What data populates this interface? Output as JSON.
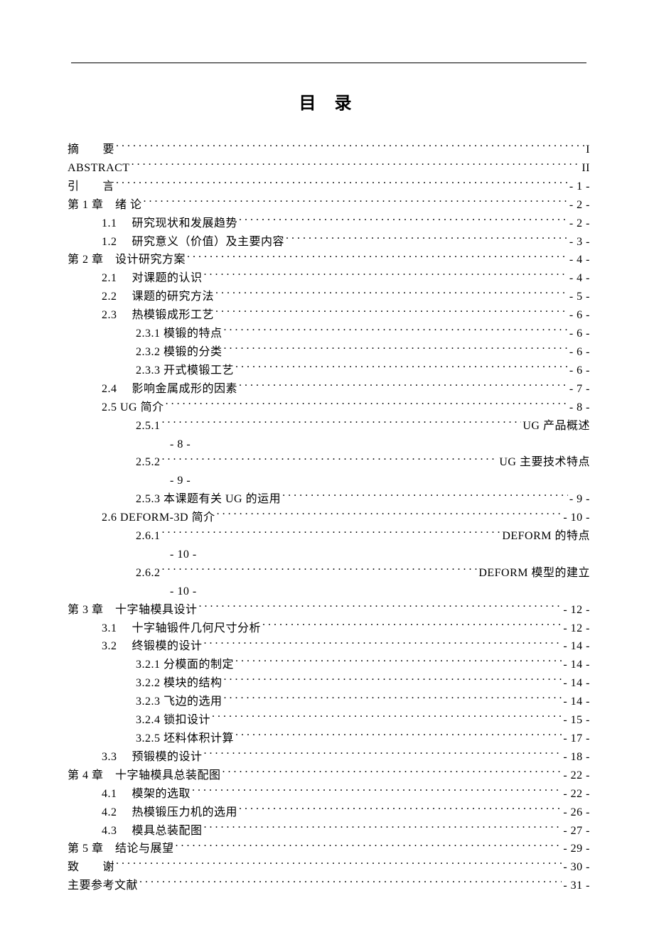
{
  "title": "目 录",
  "entries": [
    {
      "level": 0,
      "label": "摘　　要",
      "page": "I"
    },
    {
      "level": 0,
      "label": "ABSTRACT",
      "page": "II"
    },
    {
      "level": 0,
      "label": "引　　言",
      "page": "- 1 -"
    },
    {
      "level": 0,
      "label": "第 1 章　绪 论",
      "page": "- 2 -"
    },
    {
      "level": 1,
      "label": "1.1　 研究现状和发展趋势",
      "page": "- 2 -"
    },
    {
      "level": 1,
      "label": "1.2　 研究意义（价值）及主要内容",
      "page": "- 3 -"
    },
    {
      "level": 0,
      "label": "第 2 章　设计研究方案",
      "page": "- 4 -"
    },
    {
      "level": 1,
      "label": "2.1　 对课题的认识",
      "page": "- 4 -"
    },
    {
      "level": 1,
      "label": "2.2　 课题的研究方法",
      "page": "- 5 -"
    },
    {
      "level": 1,
      "label": "2.3　 热模锻成形工艺",
      "page": "- 6 -"
    },
    {
      "level": 2,
      "label": "2.3.1 模锻的特点",
      "page": "- 6 -"
    },
    {
      "level": 2,
      "label": "2.3.2 模锻的分类",
      "page": "- 6 -"
    },
    {
      "level": 2,
      "label": "2.3.3 开式模锻工艺",
      "page": "- 6 -"
    },
    {
      "level": 1,
      "label": "2.4　 影响金属成形的因素",
      "page": "- 7 -"
    },
    {
      "level": 1,
      "label": "2.5  UG 简介 ",
      "page": "- 8 -"
    },
    {
      "level": 2,
      "wrap": true,
      "label": "2.5.1 ",
      "tail": "UG 产品概述",
      "page2": "- 8 -"
    },
    {
      "level": 2,
      "wrap": true,
      "label": "2.5.2",
      "tail": "UG 主要技术特点",
      "page2": "- 9 -"
    },
    {
      "level": 2,
      "label": "2.5.3 本课题有关 UG 的运用",
      "page": "- 9 -"
    },
    {
      "level": 1,
      "label": "2.6  DEFORM-3D 简介 ",
      "page": "- 10 -"
    },
    {
      "level": 2,
      "wrap": true,
      "label": "2.6.1 ",
      "tail": "DEFORM 的特点",
      "page2": "- 10 -"
    },
    {
      "level": 2,
      "wrap": true,
      "label": "2.6.2",
      "tail": "DEFORM 模型的建立",
      "page2": "- 10 -"
    },
    {
      "level": 0,
      "label": "第 3 章　十字轴模具设计",
      "page": "- 12 -"
    },
    {
      "level": 1,
      "label": "3.1　 十字轴锻件几何尺寸分析",
      "page": "- 12 -"
    },
    {
      "level": 1,
      "label": "3.2　 终锻模的设计",
      "page": "- 14 -"
    },
    {
      "level": 2,
      "label": "3.2.1 分模面的制定",
      "page": "- 14 -"
    },
    {
      "level": 2,
      "label": "3.2.2 模块的结构",
      "page": "- 14 -"
    },
    {
      "level": 2,
      "label": "3.2.3 飞边的选用",
      "page": "- 14 -"
    },
    {
      "level": 2,
      "label": "3.2.4 锁扣设计",
      "page": "- 15 -"
    },
    {
      "level": 2,
      "label": "3.2.5 坯料体积计算",
      "page": "- 17 -"
    },
    {
      "level": 1,
      "label": "3.3　 预锻模的设计",
      "page": "- 18 -"
    },
    {
      "level": 0,
      "label": "第 4 章　十字轴模具总装配图",
      "page": "- 22 -"
    },
    {
      "level": 1,
      "label": "4.1　 模架的选取",
      "page": "- 22 -"
    },
    {
      "level": 1,
      "label": "4.2　 热模锻压力机的选用",
      "page": "- 26 -"
    },
    {
      "level": 1,
      "label": "4.3　 模具总装配图",
      "page": "- 27 -"
    },
    {
      "level": 0,
      "label": "第 5 章　结论与展望",
      "page": "- 29 -"
    },
    {
      "level": 0,
      "label": "致　　谢",
      "page": "- 30 -"
    },
    {
      "level": 0,
      "label": "主要参考文献",
      "page": "- 31 -"
    }
  ]
}
